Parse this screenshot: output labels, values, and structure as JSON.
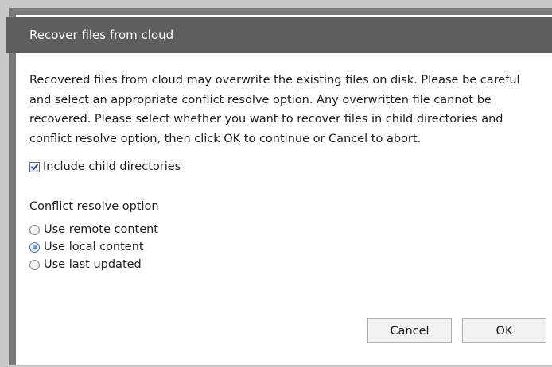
{
  "dialog": {
    "title": "Recover files from cloud",
    "message": "Recovered files from cloud may overwrite the existing files on disk. Please be careful and select an appropriate conflict resolve option. Any overwritten file cannot be recovered. Please select whether you want to recover files in child directories and conflict resolve option, then click OK to continue or Cancel to abort.",
    "include_child": {
      "label": "Include child directories",
      "checked": true
    },
    "conflict_label": "Conflict resolve option",
    "options": [
      {
        "label": "Use remote content",
        "selected": false
      },
      {
        "label": "Use local content",
        "selected": true
      },
      {
        "label": "Use last updated",
        "selected": false
      }
    ],
    "buttons": {
      "cancel": "Cancel",
      "ok": "OK"
    }
  },
  "colors": {
    "titlebar": "#5e5e5e",
    "frame": "#7a7a7a",
    "background": "#c8c8c8",
    "radio_selected": "#2f6fc0"
  }
}
